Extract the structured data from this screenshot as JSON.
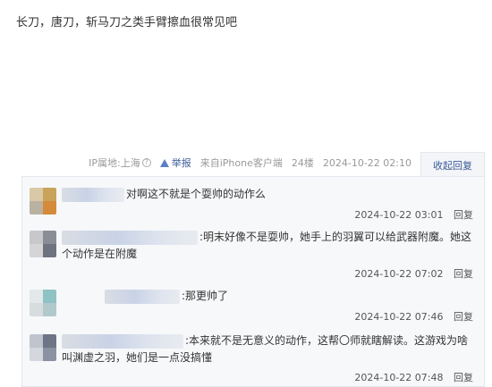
{
  "post": {
    "content": "长刀，唐刀，斩马刀之类手臂擦血很常见吧"
  },
  "meta": {
    "ip_location": "IP属地:上海",
    "report_label": "举报",
    "device": "来自iPhone客户端",
    "floor": "24楼",
    "timestamp": "2024-10-22 02:10",
    "collapse_label": "收起回复"
  },
  "replies": [
    {
      "text": "对啊这不就是个耍帅的动作么",
      "time": "2024-10-22 03:01",
      "reply_label": "回复"
    },
    {
      "text": ":明末好像不是耍帅，她手上的羽翼可以给武器附魔。她这个动作是在附魔",
      "time": "2024-10-22 07:02",
      "reply_label": "回复"
    },
    {
      "text": ":那更帅了",
      "time": "2024-10-22 07:46",
      "reply_label": "回复"
    },
    {
      "text": ":本来就不是无意义的动作，这帮〇师就瞎解读。这游戏为啥叫渊虚之羽，她们是一点没搞懂",
      "time": "2024-10-22 07:48",
      "reply_label": "回复"
    }
  ],
  "colors": {
    "link": "#3b5998",
    "meta_gray": "#999999",
    "reply_bg": "#f7f8fa",
    "border": "#e4e7ee"
  }
}
